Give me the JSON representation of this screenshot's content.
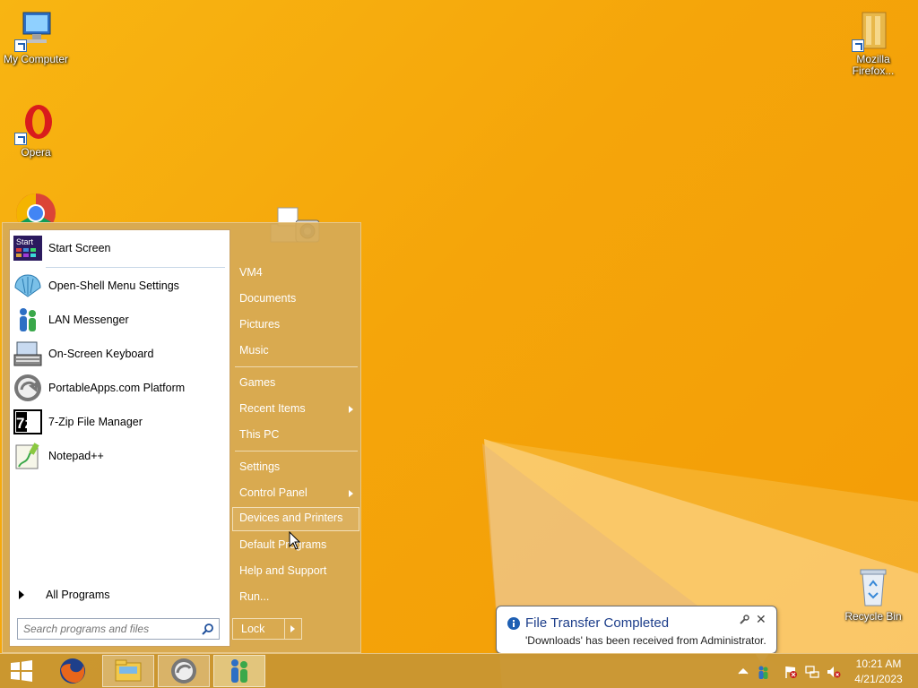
{
  "desktop": {
    "icons": [
      {
        "label": "My Computer"
      },
      {
        "label": "Opera"
      },
      {
        "label": "Mozilla Firefox..."
      },
      {
        "label": "Recycle Bin"
      }
    ]
  },
  "start_menu": {
    "programs": [
      {
        "label": "Start Screen",
        "icon": "start-screen-icon"
      },
      {
        "label": "Open-Shell Menu Settings",
        "icon": "shell-icon"
      },
      {
        "label": "LAN Messenger",
        "icon": "messenger-icon"
      },
      {
        "label": "On-Screen Keyboard",
        "icon": "keyboard-icon"
      },
      {
        "label": "PortableApps.com Platform",
        "icon": "portableapps-icon"
      },
      {
        "label": "7-Zip File Manager",
        "icon": "7zip-icon"
      },
      {
        "label": "Notepad++",
        "icon": "notepad-icon"
      }
    ],
    "start_screen_tile_text": "Start",
    "seven_zip_text": "7z",
    "all_programs": "All Programs",
    "search_placeholder": "Search programs and files",
    "right_items": [
      {
        "label": "VM4"
      },
      {
        "label": "Documents"
      },
      {
        "label": "Pictures"
      },
      {
        "label": "Music"
      },
      {
        "label": "Games"
      },
      {
        "label": "Recent Items"
      },
      {
        "label": "This PC"
      },
      {
        "label": "Settings"
      },
      {
        "label": "Control Panel"
      },
      {
        "label": "Devices and Printers"
      },
      {
        "label": "Default Programs"
      },
      {
        "label": "Help and Support"
      },
      {
        "label": "Run..."
      }
    ],
    "lock_label": "Lock"
  },
  "notification": {
    "title": "File Transfer Completed",
    "message": "'Downloads' has been received from Administrator."
  },
  "taskbar": {
    "time": "10:21 AM",
    "date": "4/21/2023"
  },
  "colors": {
    "wallpaper": "#f5a50a",
    "menu_background": "#d6aa56",
    "notification_title": "#1c3d8a"
  }
}
